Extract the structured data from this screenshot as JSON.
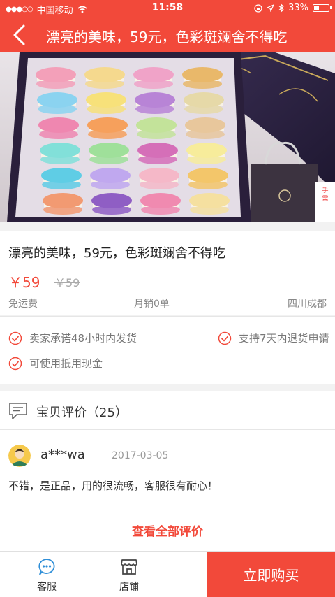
{
  "status_bar": {
    "carrier": "中国移动",
    "time": "11:58",
    "battery": "33%"
  },
  "nav": {
    "title": "漂亮的美味，59元，色彩斑斓舍不得吃"
  },
  "product": {
    "title": "漂亮的美味，59元，色彩斑斓舍不得吃",
    "price": "￥59",
    "original_price": "￥59",
    "shipping": "免运费",
    "monthly_sales": "月销0单",
    "location": "四川成都"
  },
  "guarantees": {
    "ship_48h": "卖家承诺48小时内发货",
    "return_7d": "支持7天内退货申请",
    "cash_voucher": "可使用抵用现金"
  },
  "reviews": {
    "title": "宝贝评价（25）",
    "item": {
      "user": "a***wa",
      "date": "2017-03-05",
      "text": "不错，是正品，用的很流畅，客服很有耐心！"
    },
    "view_all": "查看全部评价"
  },
  "bottom_bar": {
    "service_label": "客服",
    "shop_label": "店铺",
    "buy_label": "立即购买"
  },
  "colors": {
    "accent": "#f2493a"
  }
}
